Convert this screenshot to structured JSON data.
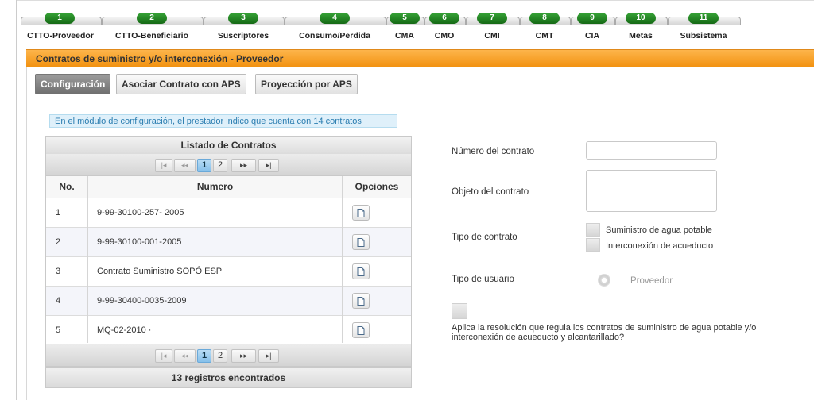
{
  "steps": [
    {
      "num": "1",
      "label": "CTTO-Proveedor"
    },
    {
      "num": "2",
      "label": "CTTO-Beneficiario"
    },
    {
      "num": "3",
      "label": "Suscriptores"
    },
    {
      "num": "4",
      "label": "Consumo/Perdida"
    },
    {
      "num": "5",
      "label": "CMA"
    },
    {
      "num": "6",
      "label": "CMO"
    },
    {
      "num": "7",
      "label": "CMI"
    },
    {
      "num": "8",
      "label": "CMT"
    },
    {
      "num": "9",
      "label": "CIA"
    },
    {
      "num": "10",
      "label": "Metas"
    },
    {
      "num": "11",
      "label": "Subsistema"
    }
  ],
  "panel": {
    "title": "Contratos de suministro y/o interconexión - Proveedor"
  },
  "tabs": [
    "Configuración",
    "Asociar Contrato con APS",
    "Proyección por APS"
  ],
  "info_message": "En el módulo de configuración, el prestador indico que cuenta con 14 contratos",
  "grid": {
    "title": "Listado de Contratos",
    "pager": {
      "first": "|◂",
      "prev": "◂◂",
      "pages": [
        "1",
        "2"
      ],
      "next": "▸▸",
      "last": "▸|"
    },
    "columns": [
      "No.",
      "Numero",
      "Opciones"
    ],
    "rows": [
      {
        "no": "1",
        "numero": "9-99-30100-257- 2005"
      },
      {
        "no": "2",
        "numero": "9-99-30100-001-2005"
      },
      {
        "no": "3",
        "numero": "Contrato Suministro SOPÓ ESP"
      },
      {
        "no": "4",
        "numero": "9-99-30400-0035-2009"
      },
      {
        "no": "5",
        "numero": "MQ-02-2010 ·"
      }
    ],
    "footer": "13 registros encontrados"
  },
  "form": {
    "numero_label": "Número del contrato",
    "numero_value": "",
    "objeto_label": "Objeto del contrato",
    "objeto_value": "",
    "tipo_contrato_label": "Tipo de contrato",
    "tipo_contrato_options": [
      "Suministro de agua potable",
      "Interconexión de acueducto"
    ],
    "tipo_usuario_label": "Tipo de usuario",
    "tipo_usuario_option": "Proveedor",
    "resolucion_text": "Aplica la resolución que regula los contratos de suministro de agua potable y/o interconexión de acueducto y alcantarillado?"
  },
  "colors": {
    "accent_orange": "#f29211",
    "step_green": "#1d7d1d",
    "info_blue": "#2a7db0"
  }
}
